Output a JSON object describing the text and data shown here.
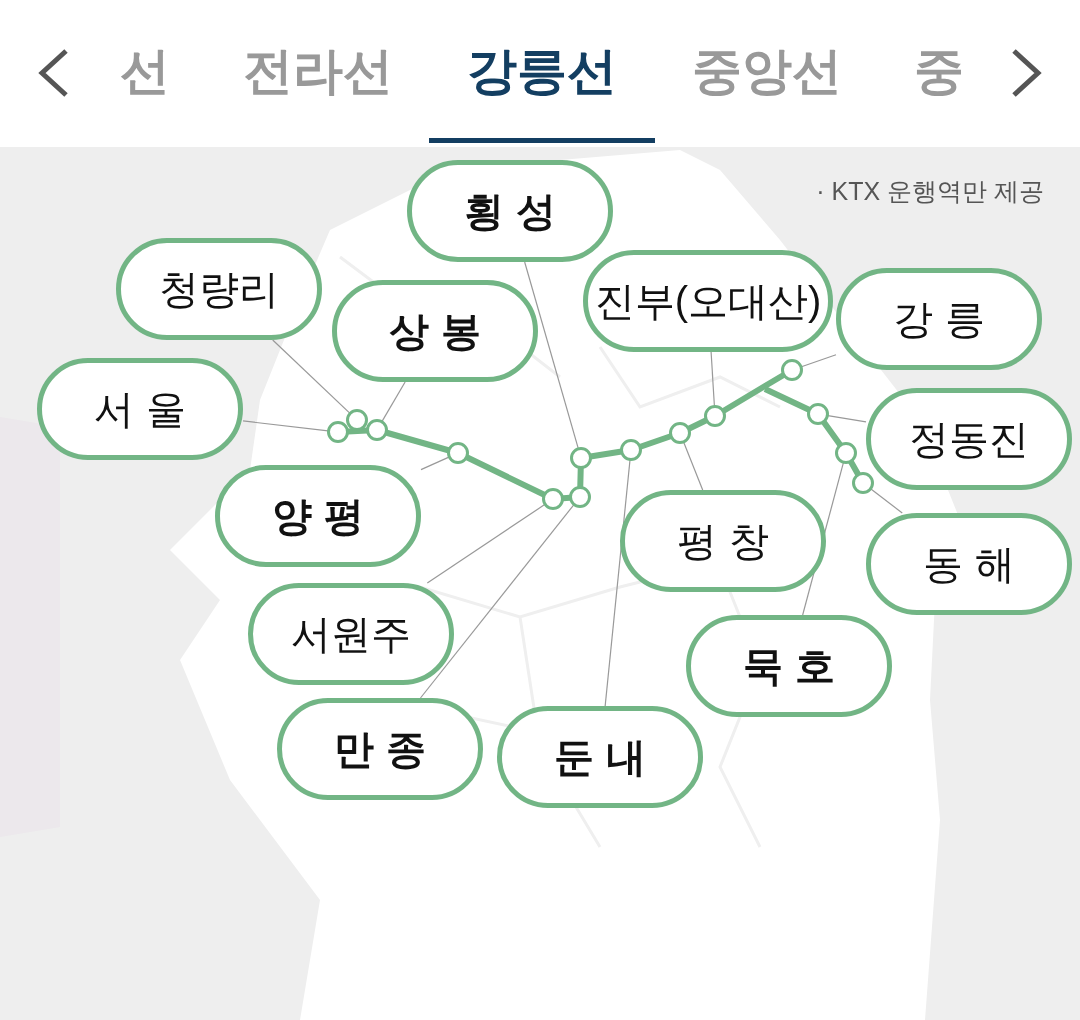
{
  "tabs": [
    {
      "label": "선",
      "selected": false
    },
    {
      "label": "전라선",
      "selected": false
    },
    {
      "label": "강릉선",
      "selected": true
    },
    {
      "label": "중앙선",
      "selected": false
    },
    {
      "label": "중",
      "selected": false
    }
  ],
  "note": "· KTX 운행역만 제공",
  "stations": [
    {
      "name": "서 울",
      "bold": false
    },
    {
      "name": "청량리",
      "bold": false
    },
    {
      "name": "상 봉",
      "bold": true
    },
    {
      "name": "양 평",
      "bold": true
    },
    {
      "name": "서원주",
      "bold": false
    },
    {
      "name": "만 종",
      "bold": true
    },
    {
      "name": "횡 성",
      "bold": true
    },
    {
      "name": "둔 내",
      "bold": true
    },
    {
      "name": "평 창",
      "bold": false
    },
    {
      "name": "진부(오대산)",
      "bold": false
    },
    {
      "name": "강 릉",
      "bold": false
    },
    {
      "name": "정동진",
      "bold": false
    },
    {
      "name": "묵 호",
      "bold": true
    },
    {
      "name": "동 해",
      "bold": false
    }
  ]
}
